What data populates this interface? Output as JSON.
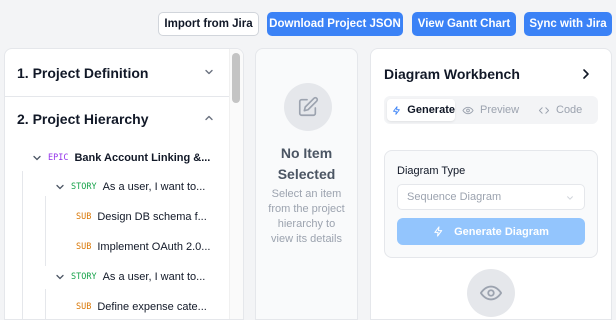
{
  "toolbar": {
    "import_label": "Import from Jira",
    "download_label": "Download Project JSON",
    "gantt_label": "View Gantt Chart",
    "sync_label": "Sync with Jira"
  },
  "hierarchy": {
    "section1": "1. Project Definition",
    "section2": "2. Project Hierarchy",
    "items": [
      {
        "type": "EPIC",
        "text": "Bank Account Linking &..."
      },
      {
        "type": "STORY",
        "text": "As a user, I want to..."
      },
      {
        "type": "SUB",
        "text": "Design DB schema f..."
      },
      {
        "type": "SUB",
        "text": "Implement OAuth 2.0..."
      },
      {
        "type": "STORY",
        "text": "As a user, I want to..."
      },
      {
        "type": "SUB",
        "text": "Define expense cate..."
      }
    ]
  },
  "detail": {
    "title": "No Item Selected",
    "description": "Select an item from the project hierarchy to view its details"
  },
  "workbench": {
    "title": "Diagram Workbench",
    "tabs": [
      "Generate",
      "Preview",
      "Code"
    ],
    "diagram_type_label": "Diagram Type",
    "diagram_type_value": "Sequence Diagram",
    "generate_button": "Generate Diagram"
  },
  "colors": {
    "primary": "#3b82f6",
    "primary_disabled": "#93c5fd",
    "epic": "#9333ea",
    "story": "#16a34a",
    "sub": "#d97706"
  }
}
